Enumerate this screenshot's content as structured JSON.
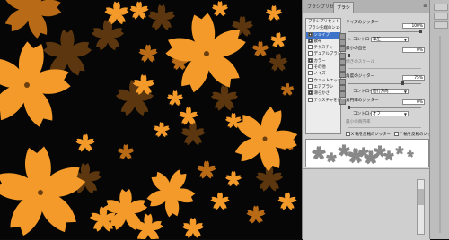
{
  "panel": {
    "tabs": [
      "ブラシプリセット",
      "ブラシ"
    ],
    "brush_list": {
      "header": [
        "ブラシプリセット",
        "ブラシ先端のシェイプ"
      ],
      "items": [
        {
          "label": "シェイプ",
          "checked": true,
          "selected": true
        },
        {
          "label": "散布",
          "checked": true,
          "selected": false
        },
        {
          "label": "テクスチャ",
          "checked": false,
          "selected": false
        },
        {
          "label": "デュアルブラシ",
          "checked": false,
          "selected": false
        },
        {
          "label": "カラー",
          "checked": true,
          "selected": false
        },
        {
          "label": "その他",
          "checked": false,
          "selected": false
        },
        {
          "label": "ノイズ",
          "checked": false,
          "selected": false
        },
        {
          "label": "ウェットエッジ",
          "checked": false,
          "selected": false
        },
        {
          "label": "エアブラシ",
          "checked": false,
          "selected": false
        },
        {
          "label": "滑らかさ",
          "checked": true,
          "selected": false
        },
        {
          "label": "テクスチャを保護",
          "checked": false,
          "selected": false
        }
      ]
    },
    "settings": {
      "size_jitter_label": "サイズのジッター",
      "size_jitter_value": "100%",
      "control_label": "コントロール",
      "control1_value": "筆圧",
      "min_diameter_label": "最小の直径",
      "min_diameter_value": "0%",
      "tilt_scale_label": "傾きのスケール",
      "angle_jitter_label": "角度のジッター",
      "angle_jitter_value": "75%",
      "control2_value": "進行方向",
      "roundness_jitter_label": "真円率のジッター",
      "roundness_jitter_value": "0%",
      "control3_value": "オフ",
      "min_roundness_label": "最小の真円率"
    },
    "checkboxes": [
      "X 軸を反転のジッター",
      "Y 軸を反転のジッター"
    ]
  },
  "colors": {
    "petal": "#f39a2a",
    "petal_dark": "#b86a16",
    "background": "#060606",
    "panel": "#d4d4d4",
    "selection": "#3d73c9"
  }
}
